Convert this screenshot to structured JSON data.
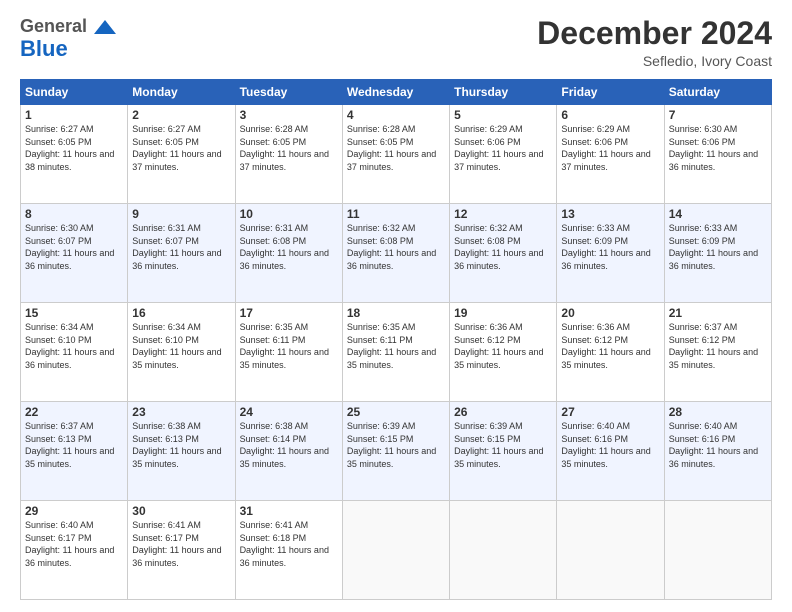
{
  "header": {
    "logo_general": "General",
    "logo_blue": "Blue",
    "month_title": "December 2024",
    "subtitle": "Sefledio, Ivory Coast"
  },
  "calendar": {
    "days_of_week": [
      "Sunday",
      "Monday",
      "Tuesday",
      "Wednesday",
      "Thursday",
      "Friday",
      "Saturday"
    ],
    "weeks": [
      [
        {
          "day": "1",
          "sunrise": "6:27 AM",
          "sunset": "6:05 PM",
          "daylight": "11 hours and 38 minutes"
        },
        {
          "day": "2",
          "sunrise": "6:27 AM",
          "sunset": "6:05 PM",
          "daylight": "11 hours and 37 minutes"
        },
        {
          "day": "3",
          "sunrise": "6:28 AM",
          "sunset": "6:05 PM",
          "daylight": "11 hours and 37 minutes"
        },
        {
          "day": "4",
          "sunrise": "6:28 AM",
          "sunset": "6:05 PM",
          "daylight": "11 hours and 37 minutes"
        },
        {
          "day": "5",
          "sunrise": "6:29 AM",
          "sunset": "6:06 PM",
          "daylight": "11 hours and 37 minutes"
        },
        {
          "day": "6",
          "sunrise": "6:29 AM",
          "sunset": "6:06 PM",
          "daylight": "11 hours and 37 minutes"
        },
        {
          "day": "7",
          "sunrise": "6:30 AM",
          "sunset": "6:06 PM",
          "daylight": "11 hours and 36 minutes"
        }
      ],
      [
        {
          "day": "8",
          "sunrise": "6:30 AM",
          "sunset": "6:07 PM",
          "daylight": "11 hours and 36 minutes"
        },
        {
          "day": "9",
          "sunrise": "6:31 AM",
          "sunset": "6:07 PM",
          "daylight": "11 hours and 36 minutes"
        },
        {
          "day": "10",
          "sunrise": "6:31 AM",
          "sunset": "6:08 PM",
          "daylight": "11 hours and 36 minutes"
        },
        {
          "day": "11",
          "sunrise": "6:32 AM",
          "sunset": "6:08 PM",
          "daylight": "11 hours and 36 minutes"
        },
        {
          "day": "12",
          "sunrise": "6:32 AM",
          "sunset": "6:08 PM",
          "daylight": "11 hours and 36 minutes"
        },
        {
          "day": "13",
          "sunrise": "6:33 AM",
          "sunset": "6:09 PM",
          "daylight": "11 hours and 36 minutes"
        },
        {
          "day": "14",
          "sunrise": "6:33 AM",
          "sunset": "6:09 PM",
          "daylight": "11 hours and 36 minutes"
        }
      ],
      [
        {
          "day": "15",
          "sunrise": "6:34 AM",
          "sunset": "6:10 PM",
          "daylight": "11 hours and 36 minutes"
        },
        {
          "day": "16",
          "sunrise": "6:34 AM",
          "sunset": "6:10 PM",
          "daylight": "11 hours and 35 minutes"
        },
        {
          "day": "17",
          "sunrise": "6:35 AM",
          "sunset": "6:11 PM",
          "daylight": "11 hours and 35 minutes"
        },
        {
          "day": "18",
          "sunrise": "6:35 AM",
          "sunset": "6:11 PM",
          "daylight": "11 hours and 35 minutes"
        },
        {
          "day": "19",
          "sunrise": "6:36 AM",
          "sunset": "6:12 PM",
          "daylight": "11 hours and 35 minutes"
        },
        {
          "day": "20",
          "sunrise": "6:36 AM",
          "sunset": "6:12 PM",
          "daylight": "11 hours and 35 minutes"
        },
        {
          "day": "21",
          "sunrise": "6:37 AM",
          "sunset": "6:12 PM",
          "daylight": "11 hours and 35 minutes"
        }
      ],
      [
        {
          "day": "22",
          "sunrise": "6:37 AM",
          "sunset": "6:13 PM",
          "daylight": "11 hours and 35 minutes"
        },
        {
          "day": "23",
          "sunrise": "6:38 AM",
          "sunset": "6:13 PM",
          "daylight": "11 hours and 35 minutes"
        },
        {
          "day": "24",
          "sunrise": "6:38 AM",
          "sunset": "6:14 PM",
          "daylight": "11 hours and 35 minutes"
        },
        {
          "day": "25",
          "sunrise": "6:39 AM",
          "sunset": "6:15 PM",
          "daylight": "11 hours and 35 minutes"
        },
        {
          "day": "26",
          "sunrise": "6:39 AM",
          "sunset": "6:15 PM",
          "daylight": "11 hours and 35 minutes"
        },
        {
          "day": "27",
          "sunrise": "6:40 AM",
          "sunset": "6:16 PM",
          "daylight": "11 hours and 35 minutes"
        },
        {
          "day": "28",
          "sunrise": "6:40 AM",
          "sunset": "6:16 PM",
          "daylight": "11 hours and 36 minutes"
        }
      ],
      [
        {
          "day": "29",
          "sunrise": "6:40 AM",
          "sunset": "6:17 PM",
          "daylight": "11 hours and 36 minutes"
        },
        {
          "day": "30",
          "sunrise": "6:41 AM",
          "sunset": "6:17 PM",
          "daylight": "11 hours and 36 minutes"
        },
        {
          "day": "31",
          "sunrise": "6:41 AM",
          "sunset": "6:18 PM",
          "daylight": "11 hours and 36 minutes"
        },
        null,
        null,
        null,
        null
      ]
    ]
  }
}
